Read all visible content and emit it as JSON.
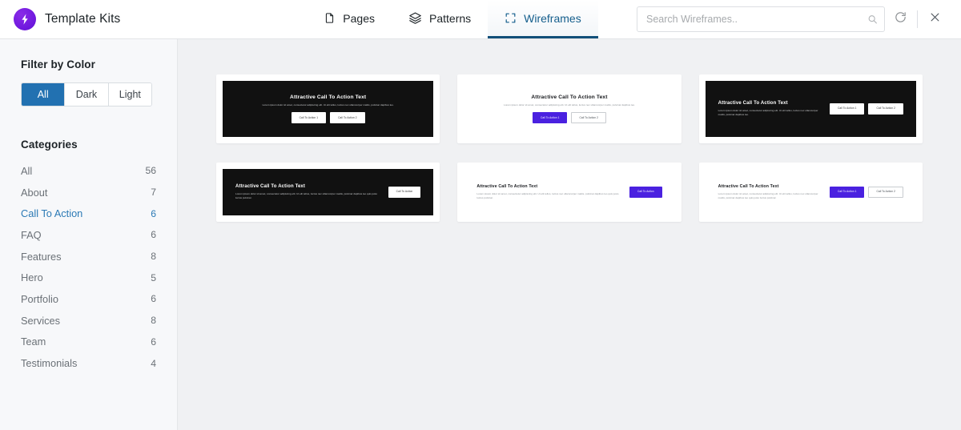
{
  "header": {
    "brand_title": "Template Kits",
    "logo_icon": "lightning-bolt-icon",
    "nav": [
      {
        "label": "Pages",
        "icon": "page-icon",
        "active": false
      },
      {
        "label": "Patterns",
        "icon": "layers-icon",
        "active": false
      },
      {
        "label": "Wireframes",
        "icon": "frame-icon",
        "active": true
      }
    ],
    "search": {
      "placeholder": "Search Wireframes..",
      "value": "",
      "icon": "search-icon"
    },
    "refresh_icon": "refresh-icon",
    "close_icon": "close-icon"
  },
  "sidebar": {
    "filter_title": "Filter by Color",
    "filter_options": [
      {
        "label": "All",
        "active": true
      },
      {
        "label": "Dark",
        "active": false
      },
      {
        "label": "Light",
        "active": false
      }
    ],
    "categories_title": "Categories",
    "categories": [
      {
        "label": "All",
        "count": "56",
        "active": false
      },
      {
        "label": "About",
        "count": "7",
        "active": false
      },
      {
        "label": "Call To Action",
        "count": "6",
        "active": true
      },
      {
        "label": "FAQ",
        "count": "6",
        "active": false
      },
      {
        "label": "Features",
        "count": "8",
        "active": false
      },
      {
        "label": "Hero",
        "count": "5",
        "active": false
      },
      {
        "label": "Portfolio",
        "count": "6",
        "active": false
      },
      {
        "label": "Services",
        "count": "8",
        "active": false
      },
      {
        "label": "Team",
        "count": "6",
        "active": false
      },
      {
        "label": "Testimonials",
        "count": "4",
        "active": false
      }
    ]
  },
  "colors": {
    "accent_blue": "#2271b1",
    "accent_purple": "#4a21e0",
    "brand_purple": "#7c18e8",
    "dark_tile": "#111111",
    "content_bg": "#f0f1f3",
    "sidebar_bg": "#f7f8fa"
  },
  "templates": [
    {
      "theme": "dark",
      "layout": "center",
      "heading": "Attractive Call To Action Text",
      "body": "Lorem ipsum dolor sit amet, consectetur adipiscing elit. Ut elit tellus, luctus nec ullamcorper mattis, pulvinar dapibus leo.",
      "buttons": [
        {
          "label": "Call To Action 1",
          "style": "outline-dark"
        },
        {
          "label": "Call To Action 2",
          "style": "outline-dark"
        }
      ]
    },
    {
      "theme": "light",
      "layout": "center",
      "heading": "Attractive Call To Action Text",
      "body": "Lorem ipsum dolor sit amet, consectetur adipiscing elit. Ut elit tellus, luctus nec ullamcorper mattis, pulvinar dapibus leo.",
      "buttons": [
        {
          "label": "Call To Action 1",
          "style": "solid-purple"
        },
        {
          "label": "Call To Action 2",
          "style": "outline-light"
        }
      ]
    },
    {
      "theme": "dark",
      "layout": "split",
      "heading": "Attractive Call To Action Text",
      "body": "Lorem ipsum dolor sit amet, consectetur adipiscing elit. Ut elit tellus, luctus nec ullamcorper mattis, pulvinar dapibus leo.",
      "buttons": [
        {
          "label": "Call To Action 1",
          "style": "outline-dark"
        },
        {
          "label": "Call To Action 2",
          "style": "outline-dark"
        }
      ]
    },
    {
      "theme": "dark",
      "layout": "split",
      "heading": "Attractive Call To Action Text",
      "body": "Lorem ipsum dolor sit amet, consectetur adipiscing elit. Ut elit tellus, luctus nec ullamcorper mattis, pulvinar dapibus leo quis justo luctus pulvinar.",
      "buttons": [
        {
          "label": "Call To Action",
          "style": "outline-dark"
        }
      ]
    },
    {
      "theme": "light",
      "layout": "split",
      "heading": "Attractive Call To Action Text",
      "body": "Lorem ipsum dolor sit amet, consectetur adipiscing elit. Ut elit tellus, luctus nec ullamcorper mattis, pulvinar dapibus leo quis justo luctus pulvinar.",
      "buttons": [
        {
          "label": "Call To Action",
          "style": "solid-purple"
        }
      ]
    },
    {
      "theme": "light",
      "layout": "split",
      "heading": "Attractive Call To Action Text",
      "body": "Lorem ipsum dolor sit amet, consectetur adipiscing elit. Ut elit tellus, luctus nec ullamcorper mattis, pulvinar dapibus leo quis justo luctus pulvinar.",
      "buttons": [
        {
          "label": "Call To Action 1",
          "style": "solid-purple"
        },
        {
          "label": "Call To Action 2",
          "style": "outline-light"
        }
      ]
    }
  ]
}
